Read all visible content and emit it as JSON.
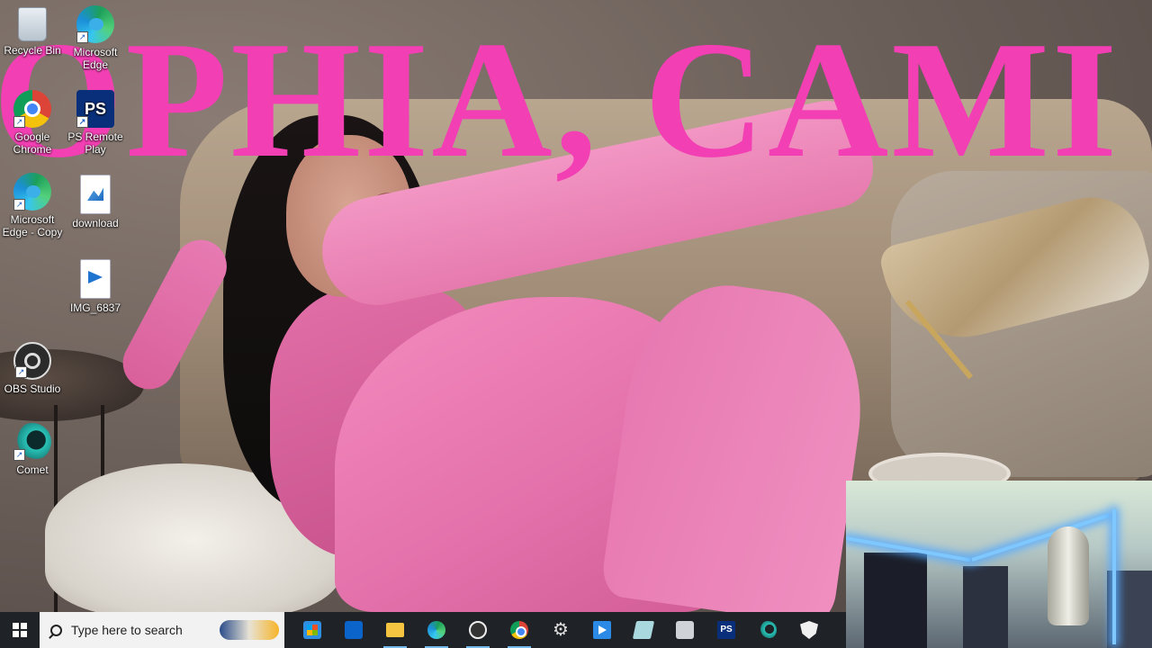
{
  "wallpaper": {
    "overlay_text": "OPHIA, CAMI",
    "overlay_color": "#f23fb3"
  },
  "desktop_icons": [
    {
      "label": "Recycle Bin",
      "icon": "recycle-bin-icon"
    },
    {
      "label": "Microsoft Edge",
      "icon": "edge-icon"
    },
    {
      "label": "Google Chrome",
      "icon": "chrome-icon"
    },
    {
      "label": "PS Remote Play",
      "icon": "ps-remote-play-icon"
    },
    {
      "label": "Microsoft Edge - Copy",
      "icon": "edge-icon"
    },
    {
      "label": "download",
      "icon": "image-file-icon"
    },
    {
      "label": "IMG_6837",
      "icon": "video-file-icon"
    },
    {
      "label": "OBS Studio",
      "icon": "obs-icon"
    },
    {
      "label": "Comet",
      "icon": "comet-icon"
    }
  ],
  "taskbar": {
    "search_placeholder": "Type here to search",
    "pinned": [
      {
        "name": "Microsoft Store",
        "icon": "store-icon"
      },
      {
        "name": "Mail",
        "icon": "mail-icon"
      },
      {
        "name": "File Explorer",
        "icon": "folder-icon"
      },
      {
        "name": "Microsoft Edge",
        "icon": "edge-icon"
      },
      {
        "name": "OBS Studio",
        "icon": "obs-icon"
      },
      {
        "name": "Google Chrome",
        "icon": "chrome-icon"
      },
      {
        "name": "Settings",
        "icon": "gear-icon"
      },
      {
        "name": "Media Player",
        "icon": "video-icon"
      },
      {
        "name": "Notes",
        "icon": "note-icon"
      },
      {
        "name": "Camera",
        "icon": "camera-icon"
      },
      {
        "name": "PS Remote Play",
        "icon": "ps-remote-play-icon"
      },
      {
        "name": "Comet",
        "icon": "comet-icon"
      },
      {
        "name": "Windows Security",
        "icon": "shield-icon"
      }
    ]
  },
  "colors": {
    "taskbar_bg": "#1f2226",
    "search_bg": "#f2f2f2",
    "led_blue": "#7ec8ff"
  }
}
